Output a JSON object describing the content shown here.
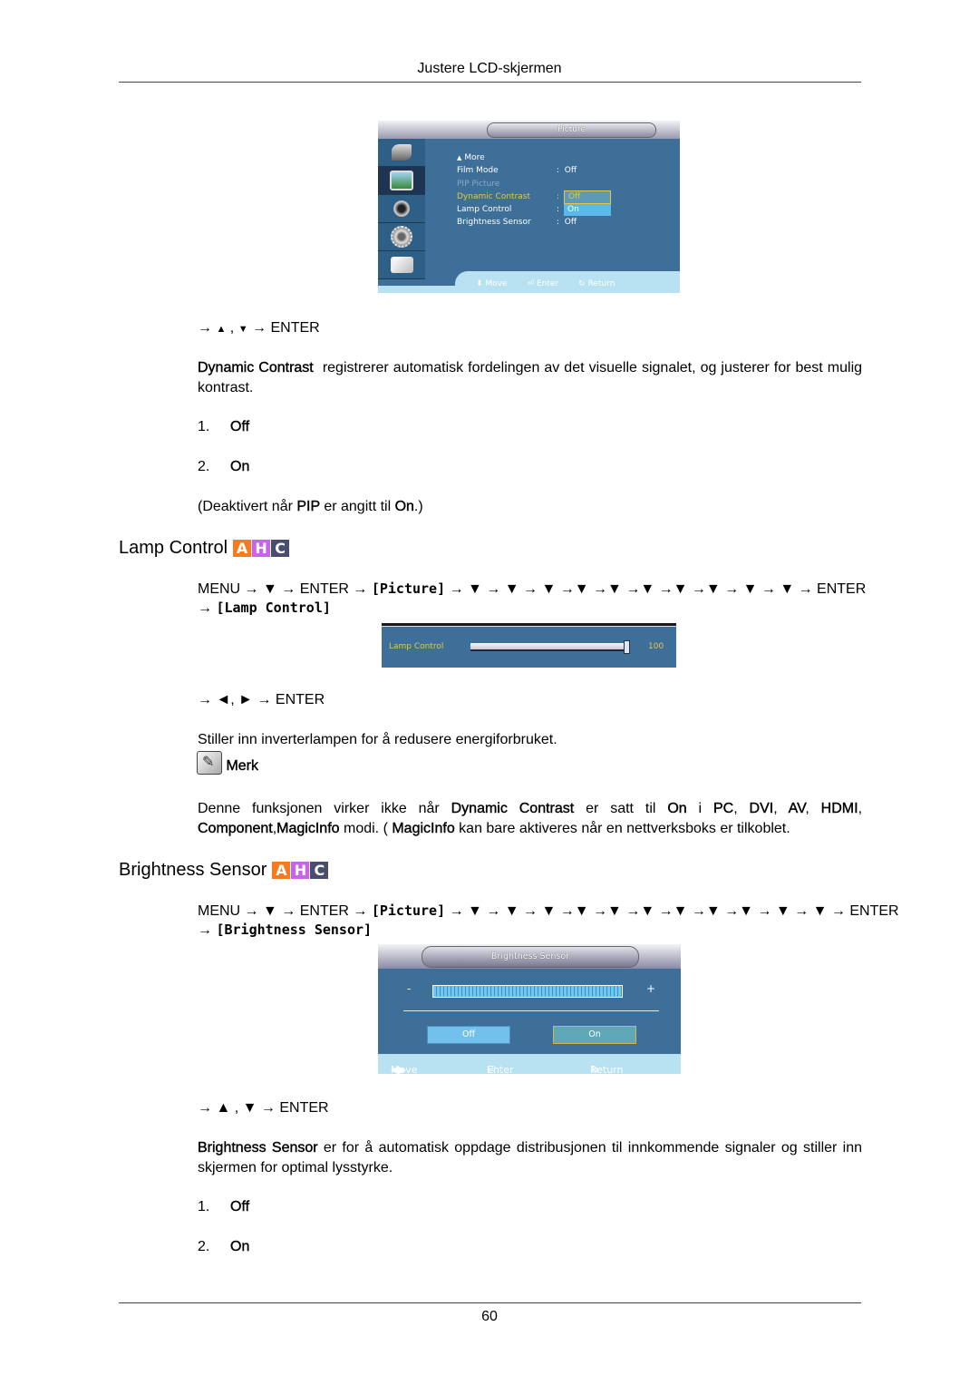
{
  "header": {
    "title": "Justere LCD-skjermen"
  },
  "osd_picture": {
    "title": "Picture",
    "sidebar_icons": [
      "input-icon",
      "picture-icon",
      "sound-icon",
      "setup-icon",
      "multi-control-icon"
    ],
    "selected_sidebar_index": 1,
    "more_label": "More",
    "items": [
      {
        "label": "Film Mode",
        "value": "Off",
        "state": "normal"
      },
      {
        "label": "PIP Picture",
        "value": "",
        "state": "disabled"
      },
      {
        "label": "Dynamic Contrast",
        "value": "",
        "state": "highlighted"
      },
      {
        "label": "Lamp Control",
        "value": "",
        "state": "normal"
      },
      {
        "label": "Brightness Sensor",
        "value": "Off",
        "state": "normal"
      }
    ],
    "dropdown_options": [
      "Off",
      "On"
    ],
    "dropdown_selected": "Off",
    "footer": {
      "move": "Move",
      "enter": "Enter",
      "return": "Return"
    }
  },
  "dynamic_contrast": {
    "nav": {
      "arrow1": "→",
      "up": "▲",
      "sep": ",",
      "down": "▼",
      "arrow2": "→",
      "enter": "ENTER"
    },
    "term": "Dynamic Contrast",
    "description": "registrerer automatisk fordelingen av det visuelle signalet, og justerer for best mulig kontrast.",
    "options": [
      {
        "num": "1.",
        "label": "Off"
      },
      {
        "num": "2.",
        "label": "On"
      }
    ],
    "note_prefix": "(Deaktivert når ",
    "note_pip": "PIP",
    "note_mid": " er angitt til ",
    "note_on": "On",
    "note_suffix": ".)"
  },
  "lamp_control": {
    "title": "Lamp Control",
    "badge": [
      "A",
      "H",
      "C"
    ],
    "nav_line1": "MENU → ▼ → ENTER → ",
    "nav_osd": "[Picture]",
    "nav_arrows": " → ▼ → ▼ → ▼ →▼ →▼ →▼ →▼ →▼ → ▼ → ▼ → ENTER",
    "nav_line2_arrow": "→ ",
    "nav_line2_osd": "[Lamp Control]",
    "osd": {
      "label": "Lamp Control",
      "value": "100",
      "value_fraction": 1.0
    },
    "adjust_nav": "→ ◄, ► → ENTER",
    "description": "Stiller inn inverterlampen for å redusere energiforbruket.",
    "note_label": "Merk",
    "note": {
      "t1": "Denne funksjonen virker ikke når ",
      "b1": "Dynamic Contrast",
      "t2": " er satt til ",
      "b2": "On",
      "t3": " i ",
      "b3": "PC",
      "t4": ", ",
      "b4": "DVI",
      "t5": ", ",
      "b5": "AV",
      "t6": ", ",
      "b6": "HDMI",
      "t7": ", ",
      "b7": "Component",
      "t8": ",",
      "b8": "MagicInfo",
      "t9": " modi. ( ",
      "b9": "MagicInfo",
      "t10": " kan bare aktiveres når en nettverksboks er tilkoblet."
    }
  },
  "brightness_sensor": {
    "title": "Brightness Sensor",
    "badge": [
      "A",
      "H",
      "C"
    ],
    "nav_line1": "MENU → ▼ → ENTER → ",
    "nav_osd": "[Picture]",
    "nav_arrows": " → ▼ → ▼ → ▼ →▼ →▼ →▼ →▼ →▼ →▼ → ▼ → ▼ → ENTER",
    "nav_line2_arrow": "→ ",
    "nav_line2_osd": "[Brightness Sensor]",
    "osd": {
      "title": "Brightness Sensor",
      "minus": "-",
      "plus": "+",
      "btn_off": "Off",
      "btn_on": "On",
      "selected": "On",
      "footer": {
        "move": "Move",
        "enter": "Enter",
        "return": "Return"
      }
    },
    "adjust_nav": "→ ▲ , ▼ → ENTER",
    "term": "Brightness Sensor",
    "description": " er for å automatisk oppdage distribusjonen til innkommende signaler og stiller inn skjermen for optimal lysstyrke.",
    "options": [
      {
        "num": "1.",
        "label": "Off"
      },
      {
        "num": "2.",
        "label": "On"
      }
    ]
  },
  "footer": {
    "page_number": "60"
  },
  "colors": {
    "osd_blue": "#3e6f99",
    "osd_highlight": "#e8c64a",
    "badge_a": "#f47b20",
    "badge_h": "#c764e8",
    "badge_c": "#4a4e6e"
  }
}
